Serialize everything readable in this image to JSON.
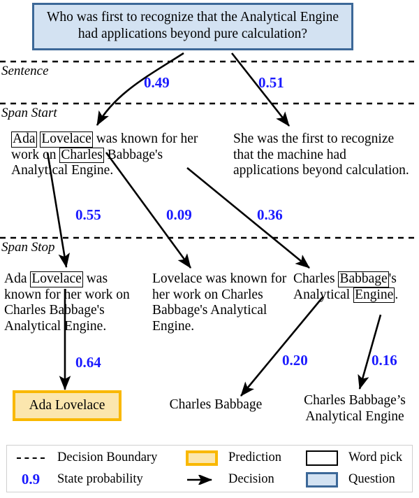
{
  "question": {
    "text": "Who was first to recognize that the Analytical Engine had applications beyond pure calculation?"
  },
  "boundaries": [
    {
      "id": "sentence",
      "label": "Sentence"
    },
    {
      "id": "span_start",
      "label": "Span Start"
    },
    {
      "id": "span_stop",
      "label": "Span Stop"
    }
  ],
  "sentence_level": {
    "left": {
      "parts": [
        {
          "text": "Ada",
          "boxed": true
        },
        {
          "text": " ",
          "boxed": false
        },
        {
          "text": "Lovelace",
          "boxed": true
        },
        {
          "text": " was known for her work on ",
          "boxed": false
        },
        {
          "text": "Charles",
          "boxed": true
        },
        {
          "text": " Babbage's Analytical Engine.",
          "boxed": false
        }
      ]
    },
    "right": {
      "parts": [
        {
          "text": "She was the first to recognize that the machine had applications beyond calculation.",
          "boxed": false
        }
      ]
    }
  },
  "span_start_level": {
    "left": {
      "parts": [
        {
          "text": "Ada ",
          "boxed": false
        },
        {
          "text": "Lovelace",
          "boxed": true
        },
        {
          "text": " was known for her work on Charles Babbage's Analytical Engine.",
          "boxed": false
        }
      ]
    },
    "middle": {
      "parts": [
        {
          "text": "Lovelace was known for her work on Charles Babbage's Analytical Engine.",
          "boxed": false
        }
      ]
    },
    "right": {
      "parts": [
        {
          "text": "Charles ",
          "boxed": false
        },
        {
          "text": "Babbage",
          "boxed": true
        },
        {
          "text": "'s Analytical ",
          "boxed": false
        },
        {
          "text": "Engine",
          "boxed": true
        },
        {
          "text": ".",
          "boxed": false
        }
      ]
    }
  },
  "answers": {
    "prediction": "Ada Lovelace",
    "alternative_1": "Charles Babbage",
    "alternative_2": "Charles Babbage’s Analytical Engine"
  },
  "probabilities": {
    "sentence_left": "0.49",
    "sentence_right": "0.51",
    "start_left": "0.55",
    "start_middle": "0.09",
    "start_right": "0.36",
    "stop_prediction": "0.64",
    "stop_alt_1": "0.20",
    "stop_alt_2": "0.16"
  },
  "legend": {
    "items": [
      {
        "key": "decision_boundary",
        "label": "Decision Boundary",
        "swatch": "dashed-line-icon"
      },
      {
        "key": "prediction",
        "label": "Prediction",
        "swatch": "prediction-box-icon"
      },
      {
        "key": "word_pick",
        "label": "Word pick",
        "swatch": "word-pick-box-icon"
      },
      {
        "key": "state_probability",
        "label": "State probability",
        "swatch": "probability-value-icon",
        "sample": "0.9"
      },
      {
        "key": "decision",
        "label": "Decision",
        "swatch": "arrow-icon"
      },
      {
        "key": "question",
        "label": "Question",
        "swatch": "question-box-icon"
      }
    ]
  },
  "colors": {
    "probability_blue": "#1a1aff",
    "question_fill": "#d3e2f2",
    "question_border": "#3c6898",
    "prediction_fill": "#fbe6ae",
    "prediction_border": "#f9b800"
  }
}
